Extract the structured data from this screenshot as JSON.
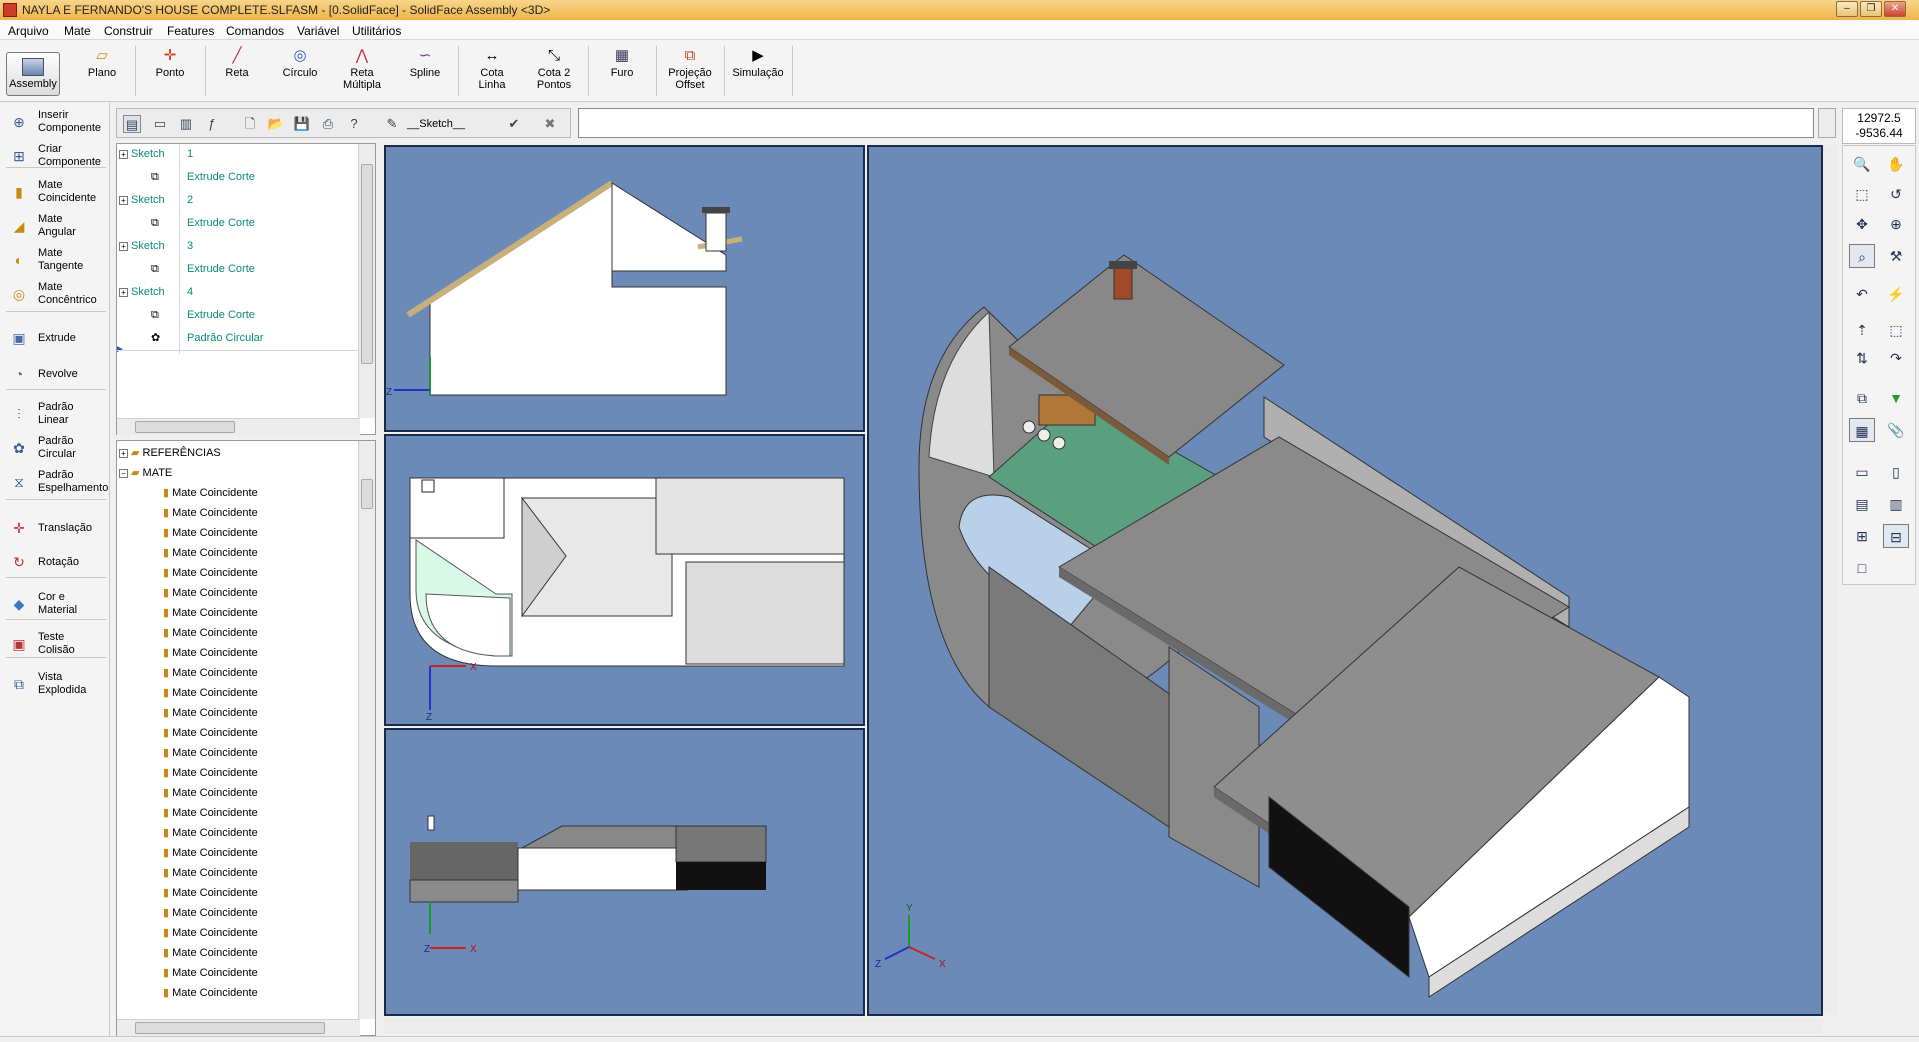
{
  "window": {
    "title": "NAYLA E FERNANDO'S HOUSE COMPLETE.SLFASM - [0.SolidFace] - SolidFace Assembly <3D>"
  },
  "menu": [
    "Arquivo",
    "Mate",
    "Construir",
    "Features",
    "Comandos",
    "Variável",
    "Utilitários"
  ],
  "ribbon": {
    "assembly": "Assembly",
    "plano": "Plano",
    "ponto": "Ponto",
    "reta": "Reta",
    "circulo": "Círculo",
    "reta_multipla_1": "Reta",
    "reta_multipla_2": "Múltipla",
    "spline": "Spline",
    "cota_linha_1": "Cota",
    "cota_linha_2": "Linha",
    "cota_2_1": "Cota 2",
    "cota_2_2": "Pontos",
    "furo": "Furo",
    "projecao_1": "Projeção",
    "projecao_2": "Offset",
    "simulacao": "Simulação"
  },
  "left_tools": [
    {
      "l1": "Inserir",
      "l2": "Componente",
      "icon": "insert-component-icon"
    },
    {
      "l1": "Criar",
      "l2": "Componente",
      "icon": "create-component-icon"
    },
    {
      "l1": "Mate",
      "l2": "Coincidente",
      "icon": "mate-coincident-icon"
    },
    {
      "l1": "Mate",
      "l2": "Angular",
      "icon": "mate-angular-icon"
    },
    {
      "l1": "Mate",
      "l2": "Tangente",
      "icon": "mate-tangent-icon"
    },
    {
      "l1": "Mate",
      "l2": "Concêntrico",
      "icon": "mate-concentric-icon"
    },
    {
      "l1": "Extrude",
      "l2": "",
      "icon": "extrude-icon"
    },
    {
      "l1": "Revolve",
      "l2": "",
      "icon": "revolve-icon"
    },
    {
      "l1": "Padrão",
      "l2": "Linear",
      "icon": "linear-pattern-icon"
    },
    {
      "l1": "Padrão",
      "l2": "Circular",
      "icon": "circular-pattern-icon"
    },
    {
      "l1": "Padrão",
      "l2": "Espelhamento",
      "icon": "mirror-pattern-icon"
    },
    {
      "l1": "Translação",
      "l2": "",
      "icon": "translation-icon"
    },
    {
      "l1": "Rotação",
      "l2": "",
      "icon": "rotation-icon"
    },
    {
      "l1": "Cor e",
      "l2": "Material",
      "icon": "color-material-icon"
    },
    {
      "l1": "Teste",
      "l2": "Colisão",
      "icon": "collision-test-icon"
    },
    {
      "l1": "Vista",
      "l2": "Explodida",
      "icon": "exploded-view-icon"
    }
  ],
  "sketch_field": "__Sketch__",
  "coords": {
    "x": "12972.5",
    "y": "-9536.44"
  },
  "feature_tree": [
    {
      "type": "Sketch",
      "num": "1"
    },
    {
      "type": "Extrude Corte"
    },
    {
      "type": "Sketch",
      "num": "2"
    },
    {
      "type": "Extrude Corte"
    },
    {
      "type": "Sketch",
      "num": "3"
    },
    {
      "type": "Extrude Corte"
    },
    {
      "type": "Sketch",
      "num": "4"
    },
    {
      "type": "Extrude Corte"
    },
    {
      "type": "Padrão Circular"
    }
  ],
  "assembly_tree": {
    "referencias": "REFERÊNCIAS",
    "mate": "MATE",
    "mates": [
      "Mate Coincidente",
      "Mate Coincidente",
      "Mate Coincidente",
      "Mate Coincidente",
      "Mate Coincidente",
      "Mate Coincidente",
      "Mate Coincidente",
      "Mate Coincidente",
      "Mate Coincidente",
      "Mate Coincidente",
      "Mate Coincidente",
      "Mate Coincidente",
      "Mate Coincidente",
      "Mate Coincidente",
      "Mate Coincidente",
      "Mate Coincidente",
      "Mate Coincidente",
      "Mate Coincidente",
      "Mate Coincidente",
      "Mate Coincidente",
      "Mate Coincidente",
      "Mate Coincidente",
      "Mate Coincidente",
      "Mate Coincidente",
      "Mate Coincidente",
      "Mate Coincidente"
    ]
  },
  "axes": {
    "x": "X",
    "y": "Y",
    "z": "Z"
  },
  "colors": {
    "viewport_bg": "#6b8ab8",
    "teal": "#0a8a7a",
    "roof": "#888888",
    "pool": "#b8d0e8",
    "lawn": "#5aa080"
  }
}
